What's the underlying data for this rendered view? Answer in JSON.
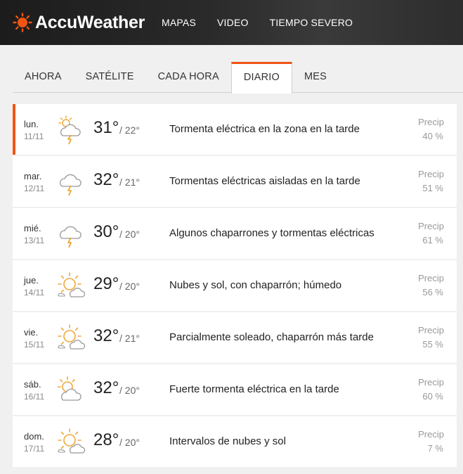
{
  "brand": {
    "name": "AccuWeather",
    "accent": "#f05514"
  },
  "nav": [
    "MAPAS",
    "VIDEO",
    "TIEMPO SEVERO"
  ],
  "tabs": [
    {
      "label": "AHORA",
      "active": false
    },
    {
      "label": "SATÉLITE",
      "active": false
    },
    {
      "label": "CADA HORA",
      "active": false
    },
    {
      "label": "DIARIO",
      "active": true
    },
    {
      "label": "MES",
      "active": false
    }
  ],
  "days": [
    {
      "dow": "lun.",
      "date": "11/11",
      "hi": "31°",
      "lo": "/ 22°",
      "phrase": "Tormenta eléctrica en la zona en la tarde",
      "precip_label": "Precip",
      "precip": "40 %",
      "icon": "thunderstorm-partly-sunny-icon",
      "selected": true
    },
    {
      "dow": "mar.",
      "date": "12/11",
      "hi": "32°",
      "lo": "/ 21°",
      "phrase": "Tormentas eléctricas aisladas en la tarde",
      "precip_label": "Precip",
      "precip": "51 %",
      "icon": "thunderstorm-icon",
      "selected": false
    },
    {
      "dow": "mié.",
      "date": "13/11",
      "hi": "30°",
      "lo": "/ 20°",
      "phrase": "Algunos chaparrones y tormentas eléctricas",
      "precip_label": "Precip",
      "precip": "61 %",
      "icon": "thunderstorm-icon",
      "selected": false
    },
    {
      "dow": "jue.",
      "date": "14/11",
      "hi": "29°",
      "lo": "/ 20°",
      "phrase": "Nubes y sol, con chaparrón; húmedo",
      "precip_label": "Precip",
      "precip": "56 %",
      "icon": "sun-cloud-icon",
      "selected": false
    },
    {
      "dow": "vie.",
      "date": "15/11",
      "hi": "32°",
      "lo": "/ 21°",
      "phrase": "Parcialmente soleado, chaparrón más tarde",
      "precip_label": "Precip",
      "precip": "55 %",
      "icon": "sun-cloud-icon",
      "selected": false
    },
    {
      "dow": "sáb.",
      "date": "16/11",
      "hi": "32°",
      "lo": "/ 20°",
      "phrase": "Fuerte tormenta eléctrica en la tarde",
      "precip_label": "Precip",
      "precip": "60 %",
      "icon": "partly-sunny-icon",
      "selected": false
    },
    {
      "dow": "dom.",
      "date": "17/11",
      "hi": "28°",
      "lo": "/ 20°",
      "phrase": "Intervalos de nubes y sol",
      "precip_label": "Precip",
      "precip": "7 %",
      "icon": "sun-cloud-icon",
      "selected": false
    }
  ]
}
